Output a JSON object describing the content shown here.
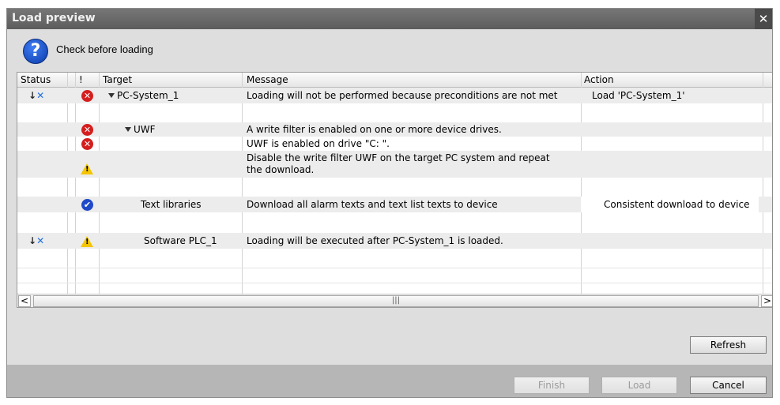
{
  "dialog": {
    "title": "Load preview",
    "close_glyph": "✕",
    "header_text": "Check before loading",
    "header_icon": "question-icon"
  },
  "table": {
    "columns": {
      "status": "Status",
      "flag": "!",
      "target": "Target",
      "message": "Message",
      "action": "Action"
    },
    "rows": [
      {
        "status_icon": "download-icon",
        "flag_icon": "error-icon",
        "target": "PC-System_1",
        "message": "Loading will not be performed because preconditions are not met",
        "action": "Load 'PC-System_1'"
      },
      {
        "flag_icon": "error-icon",
        "target": "UWF",
        "message": "A write filter is enabled on one or more device drives.",
        "action": ""
      },
      {
        "flag_icon": "error-icon",
        "target": "",
        "message": "UWF is enabled on drive \"C: \".",
        "action": ""
      },
      {
        "flag_icon": "warning-icon",
        "target": "",
        "message_line1": "Disable the write filter UWF on the target PC system and repeat",
        "message_line2": "the download.",
        "action": ""
      },
      {
        "flag_icon": "ok-icon",
        "target": "Text libraries",
        "message": "Download all alarm texts and text list texts to device",
        "action": "Consistent download to device"
      },
      {
        "status_icon": "download-icon",
        "flag_icon": "warning-icon",
        "target": "Software PLC_1",
        "message": "Loading will be executed after PC-System_1 is loaded.",
        "action": ""
      }
    ]
  },
  "scrollbar": {
    "left": "<",
    "right": ">",
    "thumb": "|||"
  },
  "buttons": {
    "refresh": "Refresh",
    "finish": "Finish",
    "load": "Load",
    "cancel": "Cancel"
  }
}
